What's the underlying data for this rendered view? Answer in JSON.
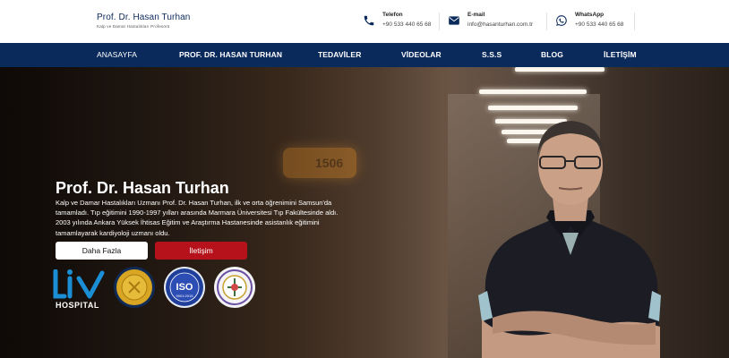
{
  "header": {
    "brand_name": "Prof. Dr. Hasan Turhan",
    "brand_subtitle": "Kalp ve Damar Hastalıkları Profesörü",
    "contacts": [
      {
        "icon": "phone-icon",
        "label": "Telefon",
        "value": "+90 533 440 65 68"
      },
      {
        "icon": "email-icon",
        "label": "E-mail",
        "value": "info@hasanturhan.com.tr"
      },
      {
        "icon": "whatsapp-icon",
        "label": "WhatsApp",
        "value": "+90 533 440 65 68"
      }
    ]
  },
  "nav": {
    "items": [
      "ANASAYFA",
      "PROF. DR. HASAN TURHAN",
      "TEDAVİLER",
      "VİDEOLAR",
      "S.S.S",
      "BLOG",
      "İLETİŞİM"
    ],
    "active_index": 0
  },
  "hero": {
    "room_number": "1506",
    "title": "Prof. Dr. Hasan Turhan",
    "text": "Kalp ve Damar Hastalıkları Uzmanı Prof. Dr. Hasan Turhan, ilk ve orta öğrenimini Samsun'da tamamladı. Tıp eğitimini 1990-1997 yılları arasında Marmara Üniversitesi Tıp Fakültesinde aldı. 2003 yılında Ankara Yüksek İhtisas Eğitim ve Araştırma Hastanesinde asistanlık eğitimini tamamlayarak kardiyoloji uzmanı oldu.",
    "btn_more": "Daha Fazla",
    "btn_contact": "İletişim"
  },
  "logos": {
    "hospital": "HOSPITAL",
    "iso_text": "ISO",
    "iso_sub": "9001:2015"
  },
  "colors": {
    "navy": "#0a2a5c",
    "accent_red": "#b5121b",
    "liv_blue": "#1b8fd6"
  }
}
